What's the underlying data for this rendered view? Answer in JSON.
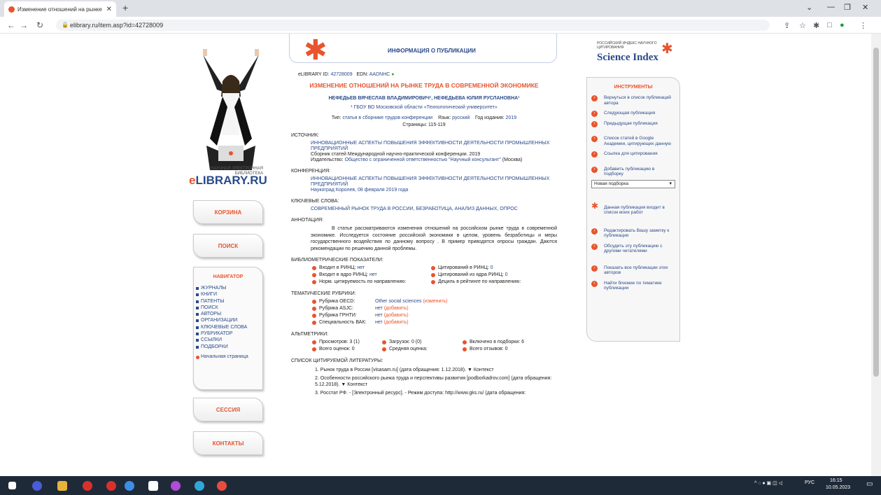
{
  "browser": {
    "tab_title": "Изменение отношений на рынке т",
    "url": "elibrary.ru/item.asp?id=42728009"
  },
  "left": {
    "logo_small": "НАУЧНАЯ ЭЛЕКТРОННАЯ БИБЛИОТЕКА",
    "logo_big_prefix": "e",
    "logo_big": "LIBRARY.RU",
    "btn_cart": "КОРЗИНА",
    "btn_search": "ПОИСК",
    "btn_session": "СЕССИЯ",
    "btn_contacts": "КОНТАКТЫ",
    "nav_title": "НАВИГАТОР",
    "nav_items": [
      "ЖУРНАЛЫ",
      "КНИГИ",
      "ПАТЕНТЫ",
      "ПОИСК",
      "АВТОРЫ",
      "ОРГАНИЗАЦИИ",
      "КЛЮЧЕВЫЕ СЛОВА",
      "РУБРИКАТОР",
      "ССЫЛКИ",
      "ПОДБОРКИ"
    ],
    "home": "Начальная страница"
  },
  "header": {
    "title": "ИНФОРМАЦИЯ О ПУБЛИКАЦИИ"
  },
  "pub": {
    "id_label": "eLIBRARY ID:",
    "id": "42728009",
    "edn_label": "EDN:",
    "edn": "AADNHC",
    "title": "ИЗМЕНЕНИЕ ОТНОШЕНИЙ НА РЫНКЕ ТРУДА В СОВРЕМЕННОЙ ЭКОНОМИКЕ",
    "authors": "НЕФЕДЬЕВ ВЯЧЕСЛАВ ВЛАДИМИРОВИЧ¹, НЕФЕДЬЕВА ЮЛИЯ РУСЛАНОВНА¹",
    "affil": "¹ ГБОУ ВО Московской области «Технологический университет»",
    "type_label": "Тип:",
    "type": "статья в сборнике трудов конференции",
    "lang_label": "Язык:",
    "lang": "русский",
    "year_label": "Год издания:",
    "year": "2019",
    "pages": "Страницы: 115-119",
    "source_h": "ИСТОЧНИК:",
    "source1": "ИННОВАЦИОННЫЕ АСПЕКТЫ ПОВЫШЕНИЯ ЭФФЕКТИВНОСТИ ДЕЯТЕЛЬНОСТИ ПРОМЫШЛЕННЫХ ПРЕДПРИЯТИЙ",
    "source2": "Сборник статей Международной научно-практической конференции. 2019",
    "source3_label": "Издательство:",
    "source3": "Общество с ограниченной ответственностью \"Научный консультант\"",
    "source3_city": "(Москва)",
    "conf_h": "КОНФЕРЕНЦИЯ:",
    "conf1": "ИННОВАЦИОННЫЕ АСПЕКТЫ ПОВЫШЕНИЯ ЭФФЕКТИВНОСТИ ДЕЯТЕЛЬНОСТИ ПРОМЫШЛЕННЫХ ПРЕДПРИЯТИЙ",
    "conf2": "Наукоград Королев, 08 февраля 2019 года",
    "kw_h": "КЛЮЧЕВЫЕ СЛОВА:",
    "kw": "СОВРЕМЕННЫЙ РЫНОК ТРУДА В РОССИИ, БЕЗРАБОТИЦА, АНАЛИЗ ДАННЫХ, ОПРОС",
    "ann_h": "АННОТАЦИЯ:",
    "ann": "В статье рассматриваются изменения отношений на российском рынке труда в современной экономике. Исследуется состояние российской экономики в целом, уровень безработицы и меры государственного воздействия по данному вопросу . В пример приводятся опросы граждан. Даются рекомендации по решению данной проблемы.",
    "bib_h": "БИБЛИОМЕТРИЧЕСКИЕ ПОКАЗАТЕЛИ:",
    "bib": [
      [
        "Входит в РИНЦ:",
        "нет",
        "Цитирований в РИНЦ:",
        "0"
      ],
      [
        "Входит в ядро РИНЦ:",
        "нет",
        "Цитирований из ядра РИНЦ:",
        "0"
      ],
      [
        "Норм. цитируемость по направлению:",
        "",
        "Дециль в рейтинге по направлению:",
        ""
      ]
    ],
    "rub_h": "ТЕМАТИЧЕСКИЕ РУБРИКИ:",
    "rub": [
      [
        "Рубрика OECD:",
        "Other social sciences",
        "(изменить)"
      ],
      [
        "Рубрика ASJC:",
        "нет",
        "(добавить)"
      ],
      [
        "Рубрика ГРНТИ:",
        "нет",
        "(добавить)"
      ],
      [
        "Специальность ВАК:",
        "нет",
        "(добавить)"
      ]
    ],
    "alt_h": "АЛЬТМЕТРИКИ:",
    "alt": [
      [
        "Просмотров: 3 (1)",
        "Загрузок: 0 (0)",
        "Включено в подборки: 6"
      ],
      [
        "Всего оценок: 0",
        "Средняя оценка:",
        "Всего отзывов: 0"
      ]
    ],
    "refs_h": "СПИСОК ЦИТИРУЕМОЙ ЛИТЕРАТУРЫ:",
    "refs": [
      "1. Рынок труда в России [visasam.ru] (дата обращения: 1.12.2018). ▼ Контекст",
      "2. Особенности российского рынка труда и перспективы развития [podborkadrov.com] (дата обращения: 5.12.2018). ▼ Контекст",
      "3. Росстат РФ. - [Электронный ресурс]. - Режим доступа: http://www.gks.ru/ (дата обращения:"
    ]
  },
  "right": {
    "sci_small": "РОССИЙСКИЙ ИНДЕКС НАУЧНОГО ЦИТИРОВАНИЯ",
    "sci_big": "Science Index",
    "tools_title": "ИНСТРУМЕНТЫ",
    "tools": [
      "Вернуться в список публикаций автора",
      "Следующая публикация",
      "Предыдущая публикация",
      "Список статей в Google Академии, цитирующих данную",
      "Ссылка для цитирования",
      "Добавить публикацию в подборку"
    ],
    "select": "Новая подборка",
    "star_item": "Данная публикация входит в список моих работ",
    "tools2": [
      "Редактировать Вашу заметку к публикации",
      "Обсудить эту публикацию с другими читателями",
      "Показать все публикации этих авторов",
      "Найти близкие по тематике публикации"
    ]
  },
  "taskbar": {
    "lang": "РУС",
    "time": "16:15",
    "date": "10.05.2023"
  }
}
